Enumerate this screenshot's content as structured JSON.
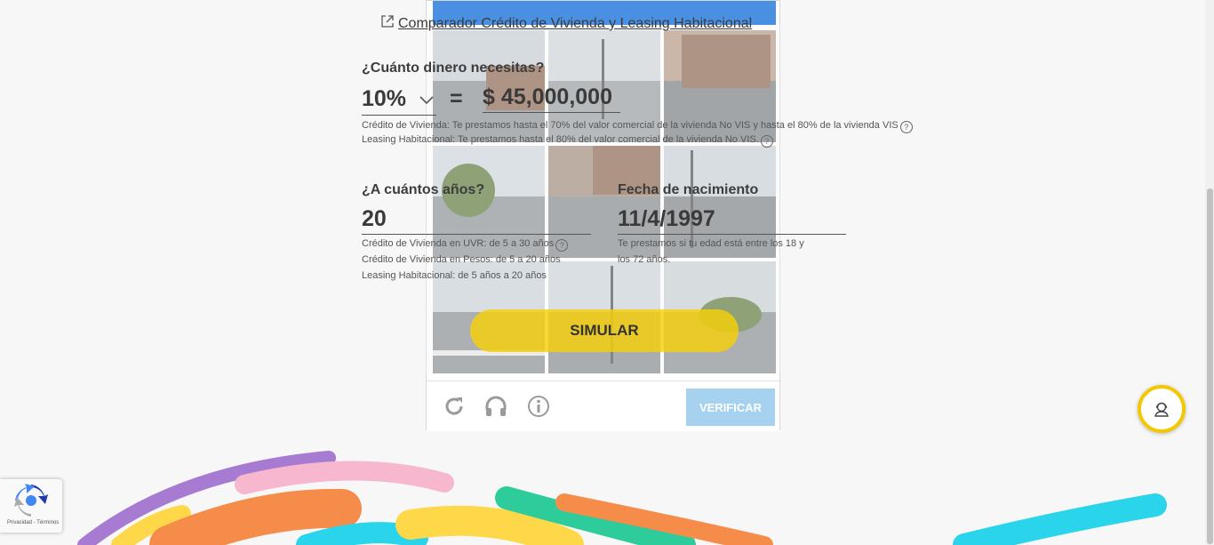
{
  "comparator_link": "Comparador Crédito de Vivienda y Leasing Habitacional",
  "amount_section": {
    "question": "¿Cuánto dinero necesitas?",
    "percent": "10%",
    "equals": "=",
    "amount": "$ 45,000,000",
    "hint_credit": "Crédito de Vivienda: Te prestamos hasta el 70% del valor comercial de la vivienda No VIS y hasta el 80% de la vivienda VIS",
    "hint_leasing": "Leasing Habitacional: Te prestamos hasta el 80% del valor comercial de la vivienda No VIS.",
    "qmark": "?"
  },
  "years_section": {
    "question": "¿A cuántos años?",
    "value": "20",
    "hint_uvr": "Crédito de Vivienda en UVR: de 5 a 30 años",
    "hint_pesos": "Crédito de Vivienda en Pesos: de 5 a 20 años",
    "hint_leasing": "Leasing Habitacional: de 5 años a 20 años"
  },
  "birth_section": {
    "label": "Fecha de nacimiento",
    "value": "11/4/1997",
    "hint_line1": "Te prestamos si tu edad está entre los 18 y",
    "hint_line2": "los 72 años."
  },
  "simulate_button": "SIMULAR",
  "captcha": {
    "verify_button": "VERIFICAR",
    "icons": [
      "reload-icon",
      "headphones-icon",
      "info-icon"
    ],
    "header_color": "#4a90e2"
  },
  "recaptcha_badge": {
    "links": "Privacidad - Términos"
  },
  "colors": {
    "accent_yellow": "#f7d00a",
    "purple": "#a77bd1",
    "pink": "#f7b8cf",
    "orange": "#f68c4a",
    "teal": "#2ecc9a",
    "cyan": "#2ad4ea"
  }
}
